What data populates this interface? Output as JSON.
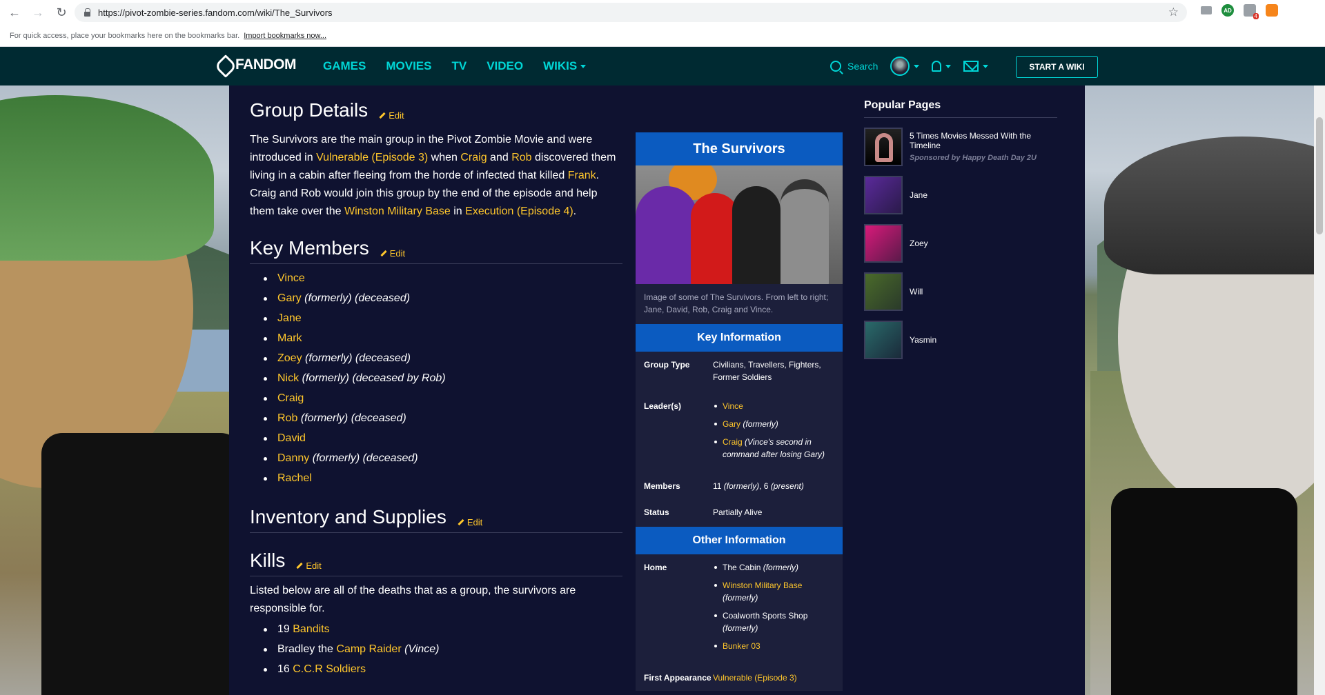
{
  "browser": {
    "url": "https://pivot-zombie-series.fandom.com/wiki/The_Survivors",
    "bookmarks_hint": "For quick access, place your bookmarks here on the bookmarks bar.",
    "import_bookmarks": "Import bookmarks now...",
    "extension_badge": "4",
    "extension_ad": "AD"
  },
  "fandom_nav": {
    "logo": "FANDOM",
    "links": [
      "GAMES",
      "MOVIES",
      "TV",
      "VIDEO",
      "WIKIS"
    ],
    "search": "Search",
    "start_wiki": "START A WIKI"
  },
  "article": {
    "edit_label": "Edit",
    "group_details": {
      "heading": "Group Details",
      "p1": "The Survivors are the main group in the Pivot Zombie Movie and were introduced in ",
      "link1": "Vulnerable (Episode 3)",
      "p2": " when ",
      "link2": "Craig",
      "p3": " and ",
      "link3": "Rob",
      "p4": " discovered them living in a cabin after fleeing from the horde of infected that killed ",
      "link4": "Frank",
      "p5": ". Craig and Rob would join this group by the end of the episode and help them take over the ",
      "link5": "Winston Military Base",
      "p6": " in ",
      "link6": "Execution (Episode 4)",
      "p7": "."
    },
    "key_members": {
      "heading": "Key Members",
      "items": [
        {
          "name": "Vince",
          "note": ""
        },
        {
          "name": "Gary",
          "note": "(formerly) (deceased)"
        },
        {
          "name": "Jane",
          "note": ""
        },
        {
          "name": "Mark",
          "note": ""
        },
        {
          "name": "Zoey",
          "note": "(formerly) (deceased)"
        },
        {
          "name": "Nick",
          "note": "(formerly) (deceased by Rob)"
        },
        {
          "name": "Craig",
          "note": ""
        },
        {
          "name": "Rob",
          "note": "(formerly) (deceased)"
        },
        {
          "name": "David",
          "note": ""
        },
        {
          "name": "Danny",
          "note": "(formerly) (deceased)"
        },
        {
          "name": "Rachel",
          "note": ""
        }
      ]
    },
    "inventory": {
      "heading": "Inventory and Supplies"
    },
    "kills": {
      "heading": "Kills",
      "intro": "Listed below are all of the deaths that as a group, the survivors are responsible for.",
      "k1_pre": "19 ",
      "k1_link": "Bandits",
      "k2_pre": "Bradley the ",
      "k2_link": "Camp Raider",
      "k2_note": "(Vince)",
      "k3_pre": "16 ",
      "k3_link": "C.C.R Soldiers"
    }
  },
  "infobox": {
    "title": "The Survivors",
    "caption": "Image of some of The Survivors. From left to right; Jane, David, Rob, Craig and Vince.",
    "key_info": "Key Information",
    "group_type_label": "Group Type",
    "group_type": "Civilians, Travellers, Fighters, Former Soldiers",
    "leaders_label": "Leader(s)",
    "leader1": "Vince",
    "leader2": "Gary",
    "leader2_note": "(formerly)",
    "leader3": "Craig",
    "leader3_note": "(Vince's second in command after losing Gary)",
    "members_label": "Members",
    "members_a": "11 ",
    "members_a_note": "(formerly)",
    "members_b": ", 6 ",
    "members_b_note": "(present)",
    "status_label": "Status",
    "status": "Partially Alive",
    "other_info": "Other Information",
    "home_label": "Home",
    "home1": "The Cabin ",
    "home1_note": "(formerly)",
    "home2": "Winston Military Base",
    "home2_note": "(formerly)",
    "home3": "Coalworth Sports Shop",
    "home3_note": "(formerly)",
    "home4": "Bunker 03",
    "first_label": "First Appearance",
    "first": "Vulnerable (Episode 3)"
  },
  "rail": {
    "title": "Popular Pages",
    "items": [
      {
        "title": "5 Times Movies Messed With the Timeline",
        "sponsor": "Sponsored by Happy Death Day 2U"
      },
      {
        "title": "Jane",
        "sponsor": ""
      },
      {
        "title": "Zoey",
        "sponsor": ""
      },
      {
        "title": "Will",
        "sponsor": ""
      },
      {
        "title": "Yasmin",
        "sponsor": ""
      }
    ]
  },
  "colors": {
    "fandom_nav_bg": "#002a32",
    "fandom_accent": "#00d6d6",
    "content_bg": "#0f1230",
    "link": "#ffc72c",
    "infobox_header": "#0b5bc0"
  }
}
